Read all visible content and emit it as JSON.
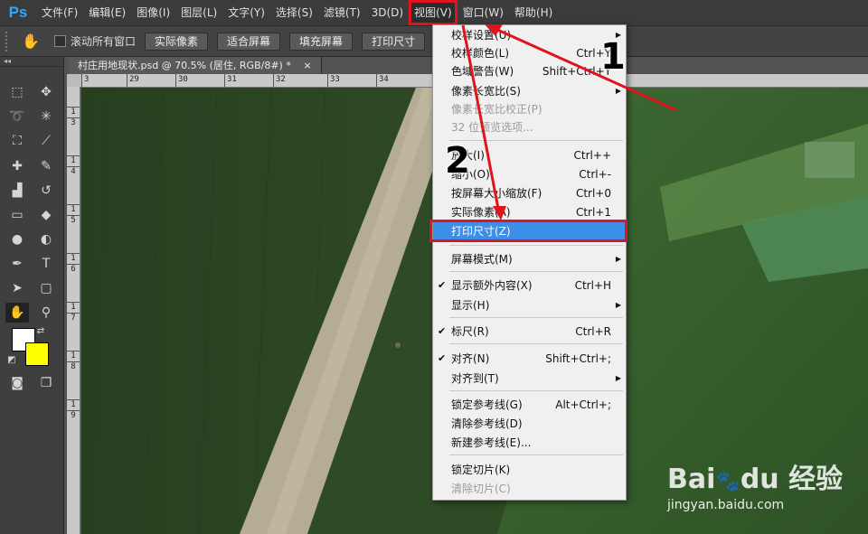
{
  "app": {
    "logo": "Ps"
  },
  "menubar": {
    "items": [
      "文件(F)",
      "编辑(E)",
      "图像(I)",
      "图层(L)",
      "文字(Y)",
      "选择(S)",
      "滤镜(T)",
      "3D(D)",
      "视图(V)",
      "窗口(W)",
      "帮助(H)"
    ],
    "active_index": 8
  },
  "options_bar": {
    "scroll_all_label": "滚动所有窗口",
    "buttons": [
      "实际像素",
      "适合屏幕",
      "填充屏幕",
      "打印尺寸"
    ]
  },
  "document_tab": {
    "title": "村庄用地现状.psd @ 70.5% (居住, RGB/8#) *",
    "close": "×"
  },
  "ruler": {
    "h_labels": [
      "3",
      "29",
      "30",
      "31",
      "32",
      "33",
      "34"
    ],
    "v_labels": [
      "1",
      "3",
      "1",
      "4",
      "1",
      "5",
      "1",
      "6",
      "1",
      "7",
      "1",
      "8",
      "1",
      "9"
    ]
  },
  "dropdown": {
    "items": [
      {
        "label": "校样设置(U)",
        "shortcut": "",
        "submenu": true,
        "checked": false,
        "disabled": false
      },
      {
        "label": "校样颜色(L)",
        "shortcut": "Ctrl+Y",
        "submenu": false,
        "checked": false,
        "disabled": false
      },
      {
        "label": "色域警告(W)",
        "shortcut": "Shift+Ctrl+Y",
        "submenu": false,
        "checked": false,
        "disabled": false
      },
      {
        "label": "像素长宽比(S)",
        "shortcut": "",
        "submenu": true,
        "checked": false,
        "disabled": false
      },
      {
        "label": "像素长宽比校正(P)",
        "shortcut": "",
        "submenu": false,
        "checked": false,
        "disabled": true
      },
      {
        "label": "32 位预览选项...",
        "shortcut": "",
        "submenu": false,
        "checked": false,
        "disabled": true
      },
      {
        "label": "放大(I)",
        "shortcut": "Ctrl++",
        "submenu": false,
        "checked": false,
        "disabled": false
      },
      {
        "label": "缩小(O)",
        "shortcut": "Ctrl+-",
        "submenu": false,
        "checked": false,
        "disabled": false
      },
      {
        "label": "按屏幕大小缩放(F)",
        "shortcut": "Ctrl+0",
        "submenu": false,
        "checked": false,
        "disabled": false
      },
      {
        "label": "实际像素(A)",
        "shortcut": "Ctrl+1",
        "submenu": false,
        "checked": false,
        "disabled": false
      },
      {
        "label": "打印尺寸(Z)",
        "shortcut": "",
        "submenu": false,
        "checked": false,
        "disabled": false,
        "highlighted": true
      },
      {
        "label": "屏幕模式(M)",
        "shortcut": "",
        "submenu": true,
        "checked": false,
        "disabled": false
      },
      {
        "label": "显示额外内容(X)",
        "shortcut": "Ctrl+H",
        "submenu": false,
        "checked": true,
        "disabled": false
      },
      {
        "label": "显示(H)",
        "shortcut": "",
        "submenu": true,
        "checked": false,
        "disabled": false
      },
      {
        "label": "标尺(R)",
        "shortcut": "Ctrl+R",
        "submenu": false,
        "checked": true,
        "disabled": false
      },
      {
        "label": "对齐(N)",
        "shortcut": "Shift+Ctrl+;",
        "submenu": false,
        "checked": true,
        "disabled": false
      },
      {
        "label": "对齐到(T)",
        "shortcut": "",
        "submenu": true,
        "checked": false,
        "disabled": false
      },
      {
        "label": "锁定参考线(G)",
        "shortcut": "Alt+Ctrl+;",
        "submenu": false,
        "checked": false,
        "disabled": false
      },
      {
        "label": "清除参考线(D)",
        "shortcut": "",
        "submenu": false,
        "checked": false,
        "disabled": false
      },
      {
        "label": "新建参考线(E)...",
        "shortcut": "",
        "submenu": false,
        "checked": false,
        "disabled": false
      },
      {
        "label": "锁定切片(K)",
        "shortcut": "",
        "submenu": false,
        "checked": false,
        "disabled": false
      },
      {
        "label": "清除切片(C)",
        "shortcut": "",
        "submenu": false,
        "checked": false,
        "disabled": true
      }
    ]
  },
  "annotations": {
    "step1": "1",
    "step2": "2"
  },
  "watermark": {
    "brand": "Bai",
    "brand2": "du",
    "cn": "经验",
    "url": "jingyan.baidu.com"
  },
  "colors": {
    "accent": "#e0141e",
    "highlight": "#3c8ee6",
    "foreground": "#ffffff",
    "background": "#ffff00"
  }
}
